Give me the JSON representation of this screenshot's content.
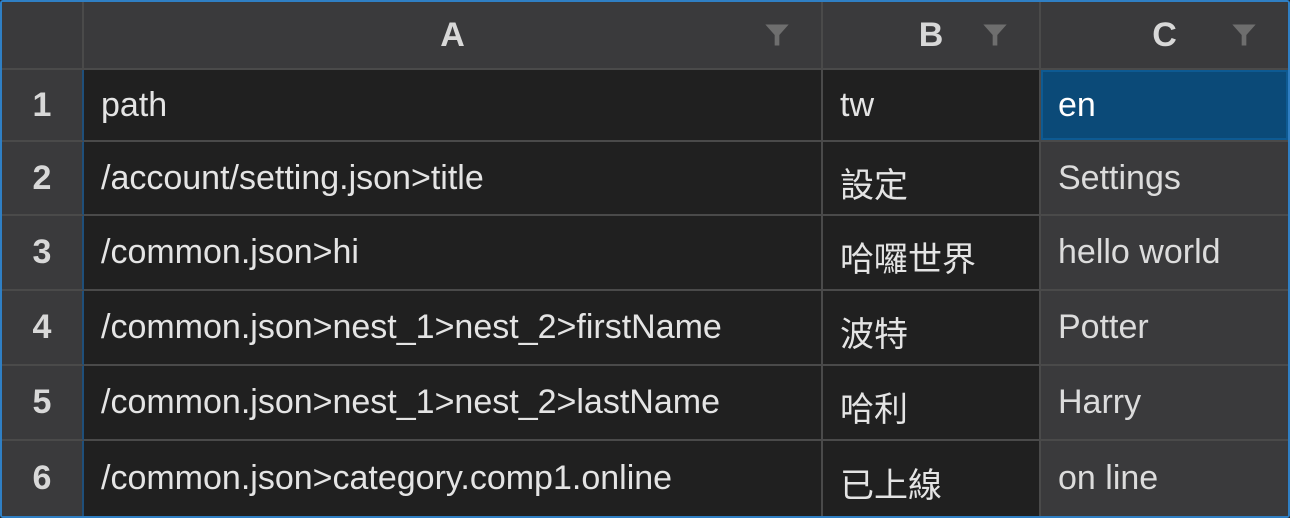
{
  "columns": [
    {
      "letter": "A",
      "filter_icon": "filter-icon"
    },
    {
      "letter": "B",
      "filter_icon": "filter-icon"
    },
    {
      "letter": "C",
      "filter_icon": "filter-icon"
    }
  ],
  "rows": [
    {
      "num": "1",
      "a": "path",
      "b": "tw",
      "c": "en"
    },
    {
      "num": "2",
      "a": "/account/setting.json>title",
      "b": "設定",
      "c": "Settings"
    },
    {
      "num": "3",
      "a": "/common.json>hi",
      "b": "哈囉世界",
      "c": "hello world"
    },
    {
      "num": "4",
      "a": "/common.json>nest_1>nest_2>firstName",
      "b": "波特",
      "c": "Potter"
    },
    {
      "num": "5",
      "a": "/common.json>nest_1>nest_2>lastName",
      "b": "哈利",
      "c": "Harry"
    },
    {
      "num": "6",
      "a": "/common.json>category.comp1.online",
      "b": "已上線",
      "c": "on line"
    }
  ],
  "selected_cell": "C1",
  "colors": {
    "accent": "#2f7fc4",
    "selection": "#0b4a78"
  }
}
